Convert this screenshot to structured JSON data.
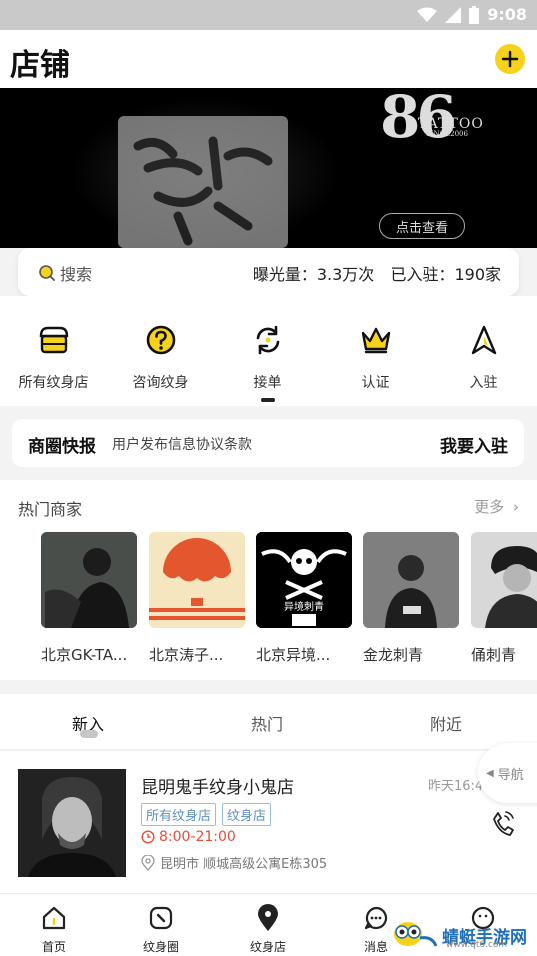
{
  "status_bar": {
    "time": "9:08"
  },
  "header": {
    "title": "店铺",
    "add_icon": "plus-icon"
  },
  "banner": {
    "logo_number": "86",
    "logo_brand": "TATTOO",
    "logo_since": "SINCE2006",
    "view_button": "点击查看"
  },
  "search": {
    "placeholder": "搜索",
    "exposure": "曝光量：3.3万次",
    "joined": "已入驻：190家"
  },
  "categories": [
    {
      "label": "所有纹身店",
      "icon": "shop-icon"
    },
    {
      "label": "咨询纹身",
      "icon": "question-icon"
    },
    {
      "label": "接单",
      "icon": "refresh-icon",
      "active": true
    },
    {
      "label": "认证",
      "icon": "crown-icon"
    },
    {
      "label": "入驻",
      "icon": "navigate-arrow-icon"
    }
  ],
  "news": {
    "title": "商圈快报",
    "text": "用户发布信息协议条款",
    "action": "我要入驻"
  },
  "hot_merchants": {
    "title": "热门商家",
    "more": "更多",
    "items": [
      {
        "name": "北京GK-TA..."
      },
      {
        "name": "北京涛子..."
      },
      {
        "name": "北京异境..."
      },
      {
        "name": "金龙刺青"
      },
      {
        "name": "俑刺青"
      }
    ],
    "studio_text": "异境刺青"
  },
  "feed_tabs": [
    {
      "label": "新入",
      "active": true
    },
    {
      "label": "热门"
    },
    {
      "label": "附近"
    }
  ],
  "listing": {
    "name": "昆明鬼手纹身小鬼店",
    "time": "昨天16:47入驻",
    "tags": [
      "所有纹身店",
      "纹身店"
    ],
    "hours": "8:00-21:00",
    "address": "昆明市 顺城高级公寓E栋305"
  },
  "nav_float": {
    "label": "导航"
  },
  "bottom_nav": [
    {
      "label": "首页",
      "icon": "home-icon"
    },
    {
      "label": "纹身圈",
      "icon": "compass-icon"
    },
    {
      "label": "纹身店",
      "icon": "location-pin-icon",
      "active": true
    },
    {
      "label": "消息",
      "icon": "chat-icon"
    },
    {
      "label": "",
      "icon": "profile-icon"
    }
  ],
  "watermark": {
    "text": "蜻蜓手游网",
    "url": "www.qt6.com"
  },
  "colors": {
    "accent": "#f7d21c",
    "tag_blue": "#5d8fc4",
    "hours_red": "#e94d3b"
  }
}
